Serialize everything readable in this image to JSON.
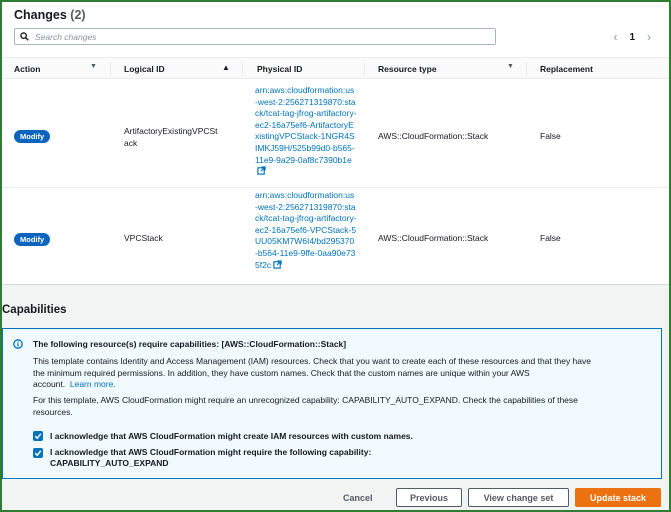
{
  "changes": {
    "title": "Changes",
    "count": "(2)",
    "search_placeholder": "Search changes",
    "pager": {
      "prev": "‹",
      "page": "1",
      "next": "›"
    },
    "columns": {
      "action": "Action",
      "logical_id": "Logical ID",
      "physical_id": "Physical ID",
      "resource_type": "Resource type",
      "replacement": "Replacement"
    },
    "rows": [
      {
        "action": "Modify",
        "logical_id_line1": "ArtifactoryExistingVPCSt",
        "logical_id_line2": "ack",
        "physical_id": "arn:aws:cloudformation:us-west-2:256271319870:stack/tcat-tag-jfrog-artifactory-ec2-16a75ef6-ArtifactoryExistingVPCStack-1NGR4SIMKJ59H/525b99d0-b565-11e9-9a29-0af8c7390b1e",
        "resource_type": "AWS::CloudFormation::Stack",
        "replacement": "False"
      },
      {
        "action": "Modify",
        "logical_id_line1": "VPCStack",
        "logical_id_line2": "",
        "physical_id": "arn:aws:cloudformation:us-west-2:256271319870:stack/tcat-tag-jfrog-artifactory-ec2-16a75ef6-VPCStack-5UU05KM7W6I4/bd295370-b564-11e9-9ffe-0aa90e735f2c",
        "resource_type": "AWS::CloudFormation::Stack",
        "replacement": "False"
      }
    ]
  },
  "capabilities": {
    "title": "Capabilities",
    "alert_heading": "The following resource(s) require capabilities: [AWS::CloudFormation::Stack]",
    "para1_line1": "This template contains Identity and Access Management (IAM) resources. Check that you want to create each of these resources and that they have",
    "para1_line2": "the minimum required permissions. In addition, they have custom names. Check that the custom names are unique within your AWS",
    "para1_line3": "account.",
    "learn_more": "Learn more.",
    "para2_line1": "For this template, AWS CloudFormation might require an unrecognized capability: CAPABILITY_AUTO_EXPAND. Check the capabilities of these",
    "para2_line2": "resources.",
    "ack1": "I acknowledge that AWS CloudFormation might create IAM resources with custom names.",
    "ack2_line1": "I acknowledge that AWS CloudFormation might require the following capability:",
    "ack2_line2": "CAPABILITY_AUTO_EXPAND"
  },
  "footer": {
    "cancel": "Cancel",
    "previous": "Previous",
    "view_change_set": "View change set",
    "update_stack": "Update stack"
  },
  "colors": {
    "link": "#0073bb",
    "badge": "#0b64be",
    "primary": "#ec7211",
    "alert_bg": "#f1faff"
  },
  "icons": [
    "search-icon",
    "external-link-icon",
    "info-icon",
    "checkbox-checked-icon",
    "sort-caret-icon"
  ]
}
